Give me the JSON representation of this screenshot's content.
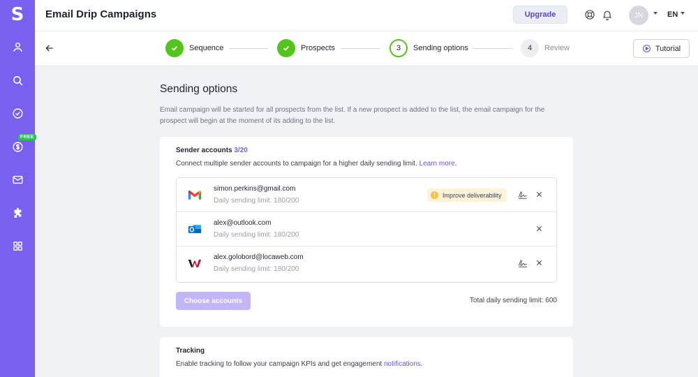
{
  "app": {
    "logo": "S",
    "title": "Email Drip Campaigns"
  },
  "sidebar": {
    "items": [
      {
        "icon": "user-icon"
      },
      {
        "icon": "search-icon"
      },
      {
        "icon": "check-circle-icon"
      },
      {
        "icon": "dollar-icon",
        "badge": "FREE"
      },
      {
        "icon": "mail-icon"
      },
      {
        "icon": "puzzle-icon"
      },
      {
        "icon": "grid-icon"
      }
    ]
  },
  "header": {
    "upgrade_label": "Upgrade",
    "avatar_initials": "JN",
    "language": "EN"
  },
  "stepper": {
    "steps": [
      {
        "label": "Sequence",
        "state": "done"
      },
      {
        "label": "Prospects",
        "state": "done"
      },
      {
        "number": "3",
        "label": "Sending options",
        "state": "current"
      },
      {
        "number": "4",
        "label": "Review",
        "state": "pending"
      }
    ],
    "tutorial_label": "Tutorial"
  },
  "main": {
    "title": "Sending options",
    "description": "Email campaign will be started for all prospects from the list. If a new prospect is added to the list, the email campaign for the prospect will begin at the moment of its adding to the list.",
    "sender_card": {
      "heading": "Sender accounts",
      "count": "3/20",
      "subtitle": "Connect multiple sender accounts to campaign for a higher daily sending limit.",
      "learn_more": "Learn more",
      "accounts": [
        {
          "email": "simon.perkins@gmail.com",
          "limit": "Daily sending limit: 180/200",
          "provider": "gmail",
          "warning": "Improve deliverability",
          "has_signature": true
        },
        {
          "email": "alex@outlook.com",
          "limit": "Daily sending limit: 180/200",
          "provider": "outlook",
          "has_signature": false
        },
        {
          "email": "alex.golobord@locaweb.com",
          "limit": "Daily sending limit: 180/200",
          "provider": "locaweb",
          "has_signature": true
        }
      ],
      "choose_label": "Choose accounts",
      "total_limit": "Total daily sending limit: 600"
    },
    "tracking_card": {
      "heading": "Tracking",
      "subtitle": "Enable tracking to follow your campaign KPIs and get engagement",
      "link": "notifications"
    }
  },
  "colors": {
    "accent": "#7b5ff0",
    "success": "#52c41a",
    "warning_bg": "#fdf3d8"
  }
}
